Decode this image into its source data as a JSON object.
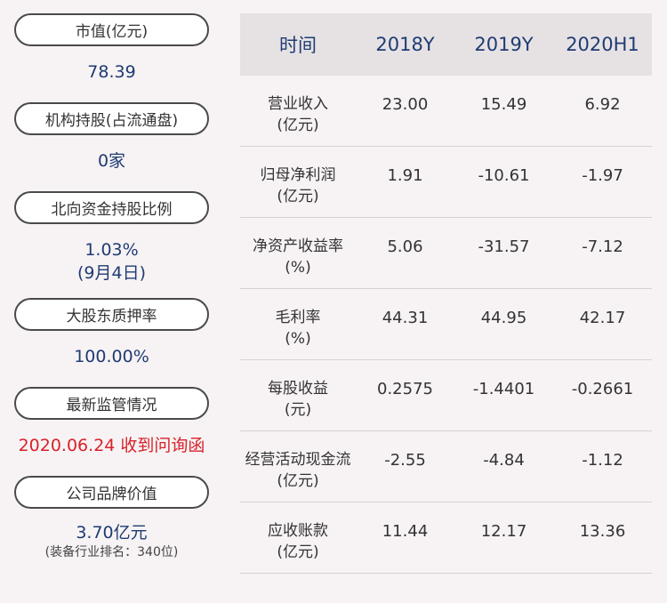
{
  "left_panel": {
    "market_cap": {
      "label": "市值(亿元)",
      "value": "78.39"
    },
    "institutional_holdings": {
      "label": "机构持股(占流通盘)",
      "value": "0家"
    },
    "northbound_ratio": {
      "label": "北向资金持股比例",
      "value": "1.03%",
      "date": "(9月4日)"
    },
    "pledge_ratio": {
      "label": "大股东质押率",
      "value": "100.00%"
    },
    "regulatory": {
      "label": "最新监管情况",
      "value": "2020.06.24 收到问询函"
    },
    "brand_value": {
      "label": "公司品牌价值",
      "value": "3.70亿元",
      "note": "(装备行业排名：340位)"
    }
  },
  "table": {
    "headers": [
      "时间",
      "2018Y",
      "2019Y",
      "2020H1"
    ],
    "rows": [
      {
        "label": "营业收入",
        "unit": "(亿元)",
        "values": [
          "23.00",
          "15.49",
          "6.92"
        ]
      },
      {
        "label": "归母净利润",
        "unit": "(亿元)",
        "values": [
          "1.91",
          "-10.61",
          "-1.97"
        ]
      },
      {
        "label": "净资产收益率",
        "unit": "(%)",
        "values": [
          "5.06",
          "-31.57",
          "-7.12"
        ]
      },
      {
        "label": "毛利率",
        "unit": "(%)",
        "values": [
          "44.31",
          "44.95",
          "42.17"
        ]
      },
      {
        "label": "每股收益",
        "unit": "(元)",
        "values": [
          "0.2575",
          "-1.4401",
          "-0.2661"
        ]
      },
      {
        "label": "经营活动现金流",
        "unit": "(亿元)",
        "values": [
          "-2.55",
          "-4.84",
          "-1.12"
        ]
      },
      {
        "label": "应收账款",
        "unit": "(亿元)",
        "values": [
          "11.44",
          "12.17",
          "13.36"
        ]
      }
    ]
  }
}
